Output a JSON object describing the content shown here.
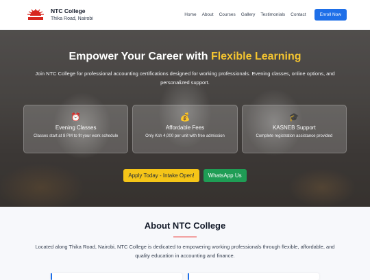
{
  "header": {
    "brand_name": "NTC College",
    "brand_location": "Thika Road, Nairobi",
    "logo_text": "NTC",
    "nav": [
      "Home",
      "About",
      "Courses",
      "Gallery",
      "Testimonials",
      "Contact"
    ],
    "enroll_label": "Enroll Now"
  },
  "hero": {
    "title_main": "Empower Your Career with ",
    "title_highlight": "Flexible Learning",
    "subtitle": "Join NTC College for professional accounting certifications designed for working professionals. Evening classes, online options, and personalized support.",
    "features": [
      {
        "icon": "alarm-clock-icon",
        "glyph": "⏰",
        "title": "Evening Classes",
        "desc": "Classes start at 8 PM to fit your work schedule"
      },
      {
        "icon": "money-bag-icon",
        "glyph": "💰",
        "title": "Affordable Fees",
        "desc": "Only Ksh 4,000 per unit with free admission"
      },
      {
        "icon": "graduation-cap-icon",
        "glyph": "🎓",
        "title": "KASNEB Support",
        "desc": "Complete registration assistance provided"
      }
    ],
    "apply_label": "Apply Today - Intake Open!",
    "whatsapp_label": "WhatsApp Us"
  },
  "about": {
    "title": "About NTC College",
    "text": "Located along Thika Road, Nairobi, NTC College is dedicated to empowering working professionals through flexible, affordable, and quality education in accounting and finance."
  },
  "colors": {
    "accent": "#1e6fe8",
    "highlight": "#f4c430",
    "apply": "#f5c518",
    "whatsapp": "#1f9d55"
  }
}
